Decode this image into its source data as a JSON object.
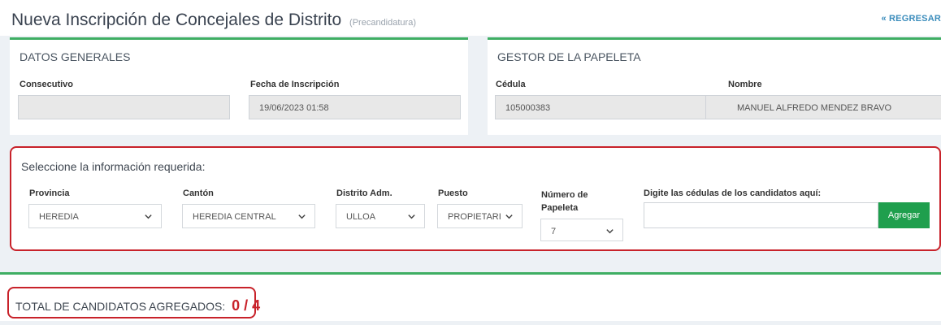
{
  "header": {
    "title": "Nueva Inscripción de Concejales de Distrito",
    "subtitle": "(Precandidatura)",
    "back_link": "« REGRESAR"
  },
  "datos_generales": {
    "title": "DATOS GENERALES",
    "consecutivo_label": "Consecutivo",
    "consecutivo_value": "",
    "fecha_label": "Fecha de Inscripción",
    "fecha_value": "19/06/2023 01:58"
  },
  "gestor": {
    "title": "GESTOR DE LA PAPELETA",
    "cedula_label": "Cédula",
    "cedula_value": "105000383",
    "nombre_label": "Nombre",
    "nombre_value": "MANUEL ALFREDO MENDEZ BRAVO"
  },
  "selection": {
    "heading": "Seleccione la información requerida:",
    "provincia_label": "Provincia",
    "provincia_value": "HEREDIA",
    "canton_label": "Cantón",
    "canton_value": "HEREDIA CENTRAL",
    "distrito_label": "Distrito Adm.",
    "distrito_value": "ULLOA",
    "puesto_label": "Puesto",
    "puesto_value": "PROPIETARI",
    "papeleta_label_1": "Número de",
    "papeleta_label_2": "Papeleta",
    "papeleta_value": "7",
    "cedulas_label": "Digite las cédulas de los candidatos aquí:",
    "cedulas_placeholder": "",
    "agregar_label": "Agregar"
  },
  "total": {
    "label": "TOTAL DE CANDIDATOS AGREGADOS:",
    "count": "0 / 4",
    "added": 0,
    "max": 4
  },
  "icons": {
    "dropdown": "chevron-down-icon"
  },
  "colors": {
    "accent_green": "#3fae63",
    "button_green": "#1f9f4d",
    "highlight_red": "#c8222a",
    "link_blue": "#3c8dbc"
  }
}
